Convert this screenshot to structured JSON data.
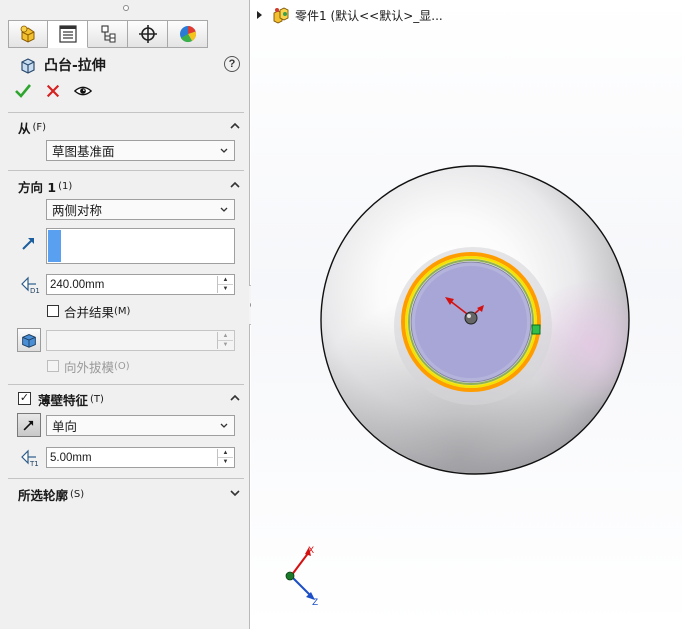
{
  "panel": {
    "tabs": [
      "feature-manager-tab",
      "property-manager-tab",
      "configuration-manager-tab",
      "dimxpert-manager-tab",
      "display-manager-tab"
    ],
    "feature_title": "凸台-拉伸",
    "help_label": "?",
    "from_group": {
      "title": "从",
      "key": "(F)",
      "start_condition": "草图基准面"
    },
    "direction1_group": {
      "title": "方向 1",
      "key": "(1)",
      "end_condition": "两侧对称",
      "depth": "240.00mm",
      "merge_result": "合并结果",
      "merge_key": "(M)",
      "draft_outward": "向外拔模",
      "draft_key": "(O)"
    },
    "thin_feature_group": {
      "title": "薄壁特征",
      "key": "(T)",
      "checked": true,
      "check_mark": "✓",
      "type": "单向",
      "thickness": "5.00mm"
    },
    "selected_contours_group": {
      "title": "所选轮廓",
      "key": "(S)"
    }
  },
  "viewport": {
    "tree_part_name": "零件1 (默认<<默认>_显...",
    "triad": {
      "x": "X",
      "z": "Z"
    }
  },
  "colors": {
    "accept": "#2ea52e",
    "cancel": "#d62020",
    "selection_blue": "#5aa0f0",
    "preview_orange": "#ff9d00",
    "preview_yellow": "#f3e200"
  }
}
